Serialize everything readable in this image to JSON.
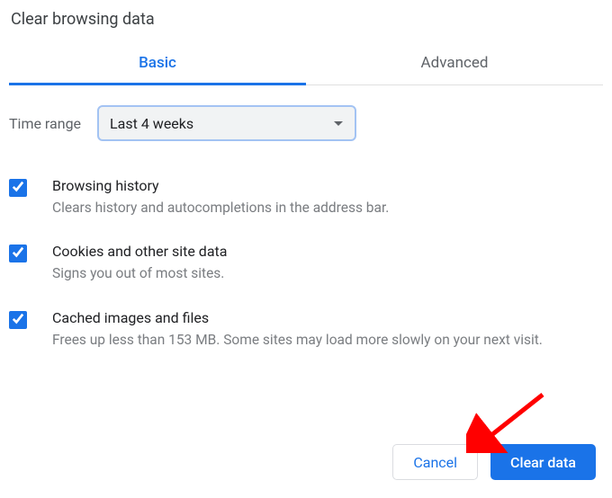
{
  "title": "Clear browsing data",
  "tabs": {
    "basic": "Basic",
    "advanced": "Advanced"
  },
  "time_range": {
    "label": "Time range",
    "value": "Last 4 weeks"
  },
  "options": [
    {
      "title": "Browsing history",
      "desc": "Clears history and autocompletions in the address bar.",
      "checked": true
    },
    {
      "title": "Cookies and other site data",
      "desc": "Signs you out of most sites.",
      "checked": true
    },
    {
      "title": "Cached images and files",
      "desc": "Frees up less than 153 MB. Some sites may load more slowly on your next visit.",
      "checked": true
    }
  ],
  "buttons": {
    "cancel": "Cancel",
    "clear": "Clear data"
  },
  "colors": {
    "accent": "#1a73e8",
    "arrow": "#ff0000"
  }
}
